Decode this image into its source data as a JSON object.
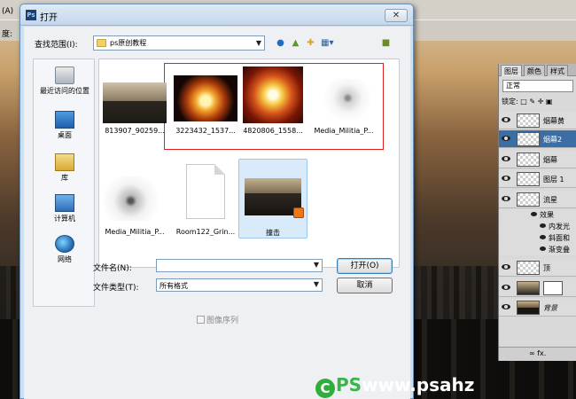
{
  "photoshop": {
    "menu_left": "(A)",
    "option_left": "度:"
  },
  "dialog": {
    "title": "打开",
    "app_icon": "Ps",
    "close": "✕",
    "look_in_label": "查找范围(I):",
    "look_in_value": "ps原创教程",
    "toolbar_icons": [
      "back-icon",
      "up-folder-icon",
      "new-folder-icon",
      "views-menu-icon"
    ],
    "places": [
      "最近访问的位置",
      "桌面",
      "库",
      "计算机",
      "网络"
    ],
    "files": [
      {
        "name": "813907_90259...",
        "kind": "city"
      },
      {
        "name": "3223432_1537...",
        "kind": "explosion"
      },
      {
        "name": "4820806_1558...",
        "kind": "explosion"
      },
      {
        "name": "Media_Militia_P...",
        "kind": "dust"
      },
      {
        "name": "Media_Militia_P...",
        "kind": "dust"
      },
      {
        "name": "Room122_Grin...",
        "kind": "document"
      },
      {
        "name": "撞击",
        "kind": "psd"
      }
    ],
    "filename_label": "文件名(N):",
    "filename_value": "",
    "filetype_label": "文件类型(T):",
    "filetype_value": "所有格式",
    "open_button": "打开(O)",
    "cancel_button": "取消",
    "image_sequence_label": "图像序列"
  },
  "layers_panel": {
    "tabs": [
      "图层",
      "颜色",
      "样式"
    ],
    "blend_mode": "正常",
    "lock_label": "锁定:",
    "layers": [
      {
        "name": "烟幕黄",
        "active": false
      },
      {
        "name": "烟幕2",
        "active": true
      },
      {
        "name": "烟幕",
        "active": false
      },
      {
        "name": "图层 1",
        "active": false
      },
      {
        "name": "流星",
        "active": false
      }
    ],
    "effects_label": "效果",
    "effects": [
      "内发光",
      "斜面和",
      "渐变叠"
    ],
    "more_layers": [
      "顶",
      "",
      "背景"
    ],
    "bottom_icons": "∞ fx."
  },
  "watermark": {
    "logo": "C",
    "ps": "PS",
    "text": "www.psahz"
  }
}
